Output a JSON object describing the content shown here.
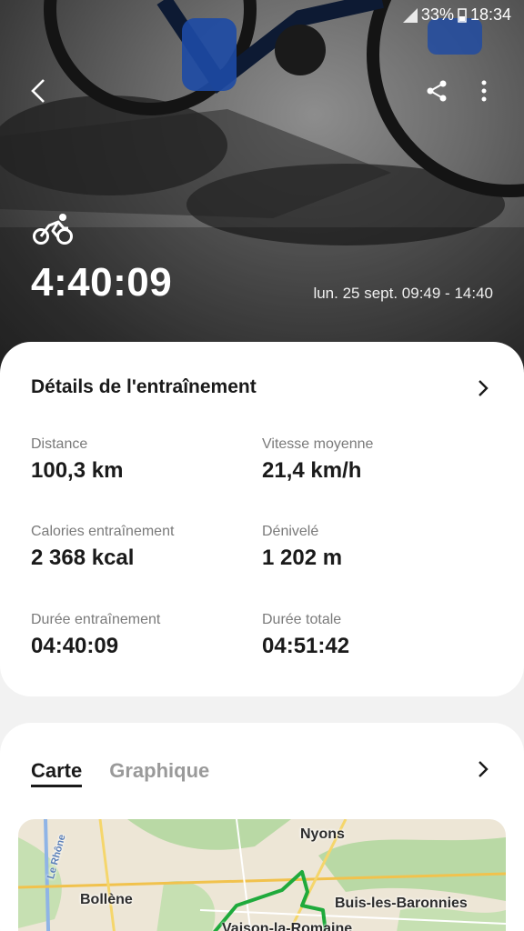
{
  "status_bar": {
    "battery": "33%",
    "time": "18:34"
  },
  "header": {
    "back_icon": "chevron-left-icon",
    "share_icon": "share-icon",
    "more_icon": "more-vertical-icon",
    "activity_icon": "bicycle-icon"
  },
  "workout": {
    "duration": "4:40:09",
    "date_range": "lun. 25 sept. 09:49 - 14:40"
  },
  "details": {
    "title": "Détails de l'entraînement",
    "stats": [
      {
        "label": "Distance",
        "value": "100,3 km"
      },
      {
        "label": "Vitesse moyenne",
        "value": "21,4 km/h"
      },
      {
        "label": "Calories entraînement",
        "value": "2 368 kcal"
      },
      {
        "label": "Dénivelé",
        "value": "1 202 m"
      },
      {
        "label": "Durée entraînement",
        "value": "04:40:09"
      },
      {
        "label": "Durée totale",
        "value": "04:51:42"
      }
    ]
  },
  "map_section": {
    "tabs": [
      "Carte",
      "Graphique"
    ],
    "active_tab": "Carte",
    "places": [
      "Nyons",
      "Bollène",
      "Buis-les-Baronnies",
      "Vaison-la-Romaine",
      "Le Rhône"
    ],
    "route_color": "#1faa3c"
  }
}
